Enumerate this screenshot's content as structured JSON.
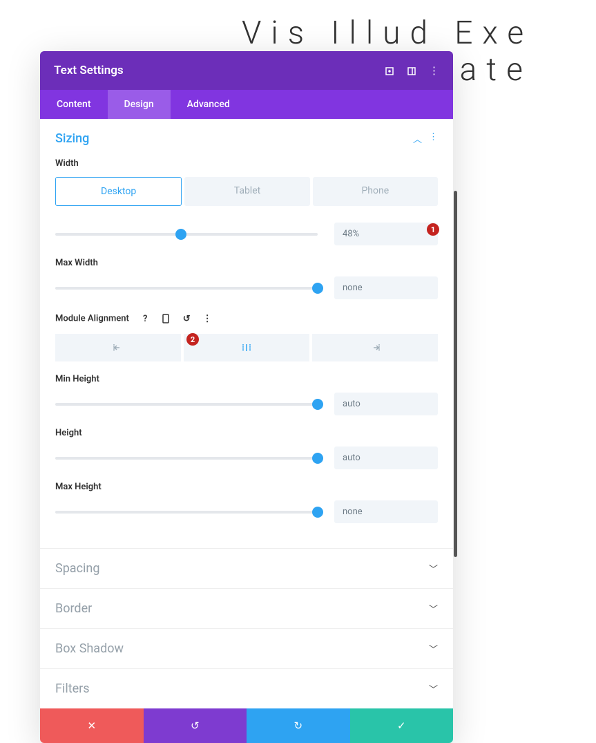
{
  "bg_line1": "Vis Illud Exe",
  "bg_line2": "Mediocritate",
  "panel_title": "Text Settings",
  "tabs": {
    "content": "Content",
    "design": "Design",
    "advanced": "Advanced"
  },
  "sizing": {
    "title": "Sizing",
    "width_label": "Width",
    "width_value": "48%",
    "dev_desktop": "Desktop",
    "dev_tablet": "Tablet",
    "dev_phone": "Phone",
    "maxwidth_label": "Max Width",
    "maxwidth_value": "none",
    "align_label": "Module Alignment",
    "minheight_label": "Min Height",
    "minheight_value": "auto",
    "height_label": "Height",
    "height_value": "auto",
    "maxheight_label": "Max Height",
    "maxheight_value": "none"
  },
  "sections": {
    "spacing": "Spacing",
    "border": "Border",
    "box_shadow": "Box Shadow",
    "filters": "Filters"
  },
  "markers": {
    "one": "1",
    "two": "2"
  }
}
